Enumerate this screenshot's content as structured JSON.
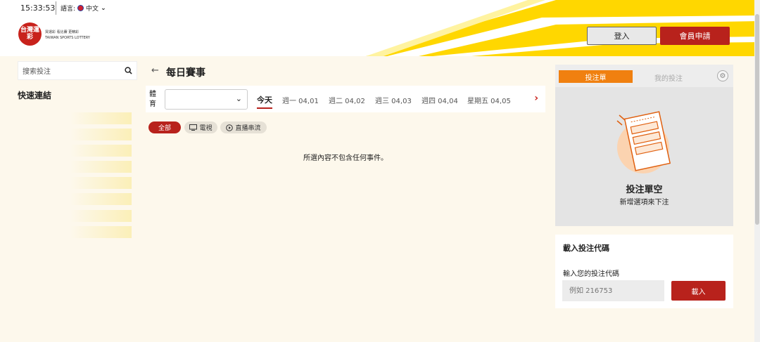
{
  "header": {
    "time": "15:33:53",
    "language_label": "語言:",
    "language_value": "中文",
    "logo_text": "台灣運彩",
    "logo_caption_1": "買運彩  看比賽  更精彩",
    "logo_caption_2": "TAIWAN SPORTS LOTTERY",
    "login_label": "登入",
    "register_label": "會員申請"
  },
  "sidebar": {
    "search_placeholder": "搜索投注",
    "quick_links_title": "快速連結"
  },
  "main": {
    "page_title": "每日賽事",
    "sport_label": "體育",
    "day_tabs": [
      {
        "label": "今天"
      },
      {
        "label": "週一 04,01"
      },
      {
        "label": "週二 04,02"
      },
      {
        "label": "週三 04,03"
      },
      {
        "label": "週四 04,04"
      },
      {
        "label": "星期五 04,05"
      }
    ],
    "chips": {
      "all": "全部",
      "tv": "電視",
      "stream": "直播串流"
    },
    "empty_message": "所選內容不包含任何事件。"
  },
  "betslip": {
    "tab_slip": "投注單",
    "tab_my_bets": "我的投注",
    "empty_title": "投注單空",
    "empty_subtitle": "新增選項來下注"
  },
  "code_panel": {
    "title": "載入投注代碼",
    "label": "輸入您的投注代碼",
    "placeholder": "例如 216753",
    "button": "載入"
  },
  "colors": {
    "brand_red": "#b8221c",
    "accent_orange": "#f08010",
    "stripe_yellow": "#ffd700"
  }
}
